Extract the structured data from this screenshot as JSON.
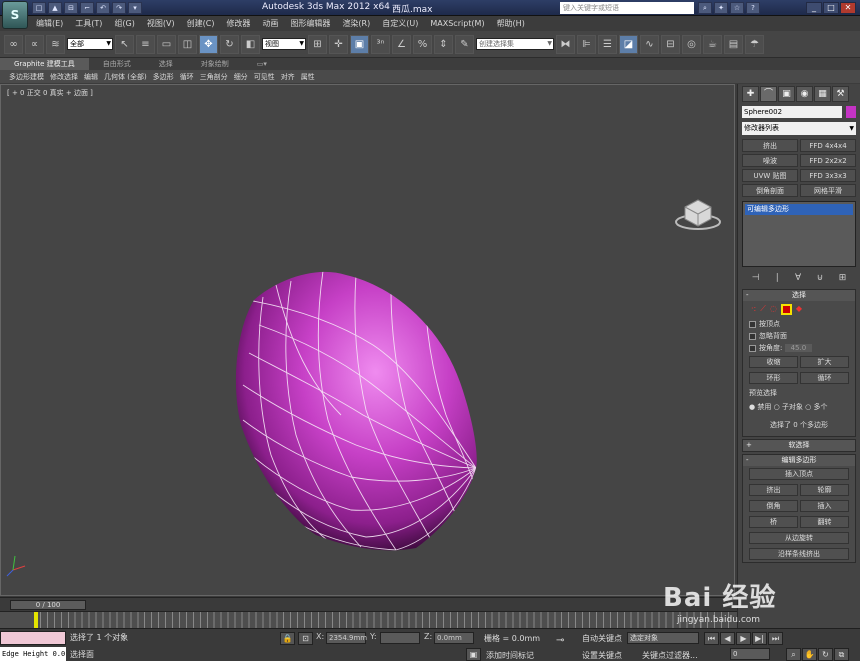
{
  "titlebar": {
    "logo": "S",
    "quick_access": [
      "□",
      "▲",
      "⊟",
      "⌐",
      "↶",
      "↷",
      "▾"
    ],
    "app_title": "Autodesk 3ds Max 2012 x64",
    "file_name": "西瓜.max",
    "search_placeholder": "键入关键字或短语",
    "tool_icons": [
      "⌕",
      "✦",
      "☆",
      "?"
    ],
    "window_buttons": [
      "_",
      "□",
      "✕"
    ]
  },
  "menubar": [
    "编辑(E)",
    "工具(T)",
    "组(G)",
    "视图(V)",
    "创建(C)",
    "修改器",
    "动画",
    "图形编辑器",
    "渲染(R)",
    "自定义(U)",
    "MAXScript(M)",
    "帮助(H)"
  ],
  "toolbar": {
    "filter_value": "全部",
    "view_value": "视图",
    "named_selection_placeholder": "创建选择集"
  },
  "ribbon": {
    "tabs": [
      "Graphite 建模工具",
      "自由形式",
      "选择",
      "对象绘制"
    ],
    "active": 0,
    "sub_items": [
      "多边形建模",
      "修改选择",
      "编辑",
      "几何体 (全部)",
      "多边形",
      "循环",
      "三角剖分",
      "细分",
      "可见性",
      "对齐",
      "属性"
    ]
  },
  "viewport": {
    "label": "[ + 0 正交 0 真实 + 边面 ]",
    "mesh_color": "#c640c6",
    "wire_color": "#f7e8f7"
  },
  "command_panel": {
    "tabs": [
      "✚",
      "⌒",
      "▣",
      "◉",
      "▦",
      "⚒"
    ],
    "object_name": "Sphere002",
    "object_color": "#c433c4",
    "modifier_list": "修改器列表",
    "modifier_buttons": [
      "挤出",
      "FFD 4x4x4",
      "噪波",
      "FFD 2x2x2",
      "UVW 贴图",
      "FFD 3x3x3",
      "倒角剖面",
      "网格平滑"
    ],
    "stack_item": "可编辑多边形",
    "stack_icons": [
      "⊣",
      "∣",
      "∀",
      "⊍",
      "⊞"
    ],
    "selection_title": "选择",
    "by_vertex": "按顶点",
    "ignore_backfacing": "忽略背面",
    "by_angle": "按角度:",
    "angle_value": "45.0",
    "shrink": "收缩",
    "grow": "扩大",
    "ring": "环形",
    "loop": "循环",
    "preview_selection": "预览选择",
    "disable": "禁用",
    "sub_object": "子对象",
    "multi": "多个",
    "selected_info": "选择了 0 个多边形",
    "soft_selection": "软选择",
    "edit_polygons": "编辑多边形",
    "insert_vertex": "插入顶点",
    "edit_buttons": [
      "挤出",
      "轮廓",
      "倒角",
      "插入",
      "桥",
      "翻转"
    ],
    "hinge": "从边旋转",
    "extrude_spline": "沿样条线挤出"
  },
  "timeline": {
    "frame_label": "0 / 100"
  },
  "statusbar": {
    "mode": "Edge Height 0.0",
    "selected_text": "选择了 1 个对象",
    "prompt": "选择面",
    "x_label": "X:",
    "x_value": "2354.9mm",
    "y_label": "Y:",
    "y_value": "",
    "z_label": "Z:",
    "z_value": "0.0mm",
    "grid": "栅格 = 0.0mm",
    "auto_key": "自动关键点",
    "key_mode": "选定对象",
    "set_key": "设置关键点",
    "key_filters": "关键点过滤器...",
    "add_time_tag": "添加时间标记",
    "frame_value": "0"
  },
  "watermark": {
    "brand": "Bai 经验",
    "url": "jingyan.baidu.com"
  }
}
